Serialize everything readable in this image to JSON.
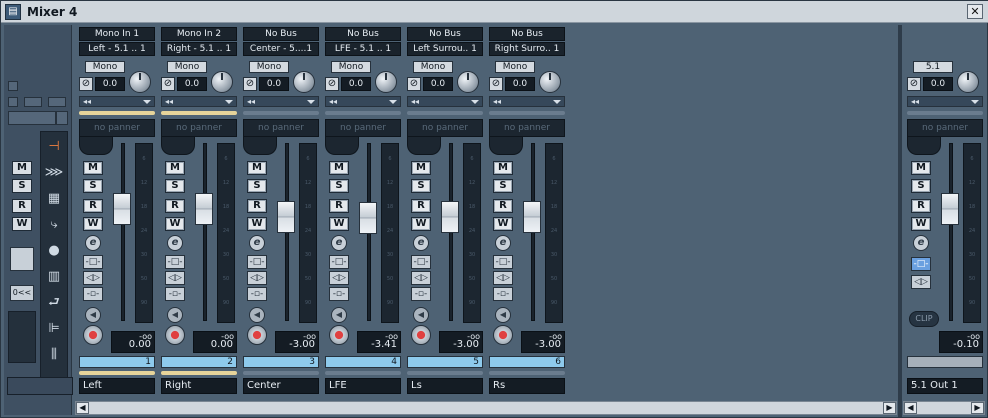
{
  "window": {
    "title": "Mixer 4",
    "close_glyph": "✕",
    "app_icon": "mixer-app-icon"
  },
  "left_panel": {
    "letters": [
      "M",
      "S",
      "R",
      "W"
    ],
    "view_button_label": "0<<",
    "tools": [
      "input-icon",
      "monitor-icon",
      "sends-icon",
      "insert-icon",
      "midi-icon",
      "keyboard-icon",
      "return-icon",
      "fader-icon",
      "eq-icon"
    ]
  },
  "channels": [
    {
      "input": "Mono In 1",
      "output": "Left - 5.1 .. 1",
      "mono": "Mono",
      "gain": "0.0",
      "panner": "no panner",
      "level": "0.00",
      "level_peak": "-oo",
      "number": "1",
      "name": "Left",
      "fader_db": 0.0,
      "send_active": true
    },
    {
      "input": "Mono In 2",
      "output": "Right - 5.1 .. 1",
      "mono": "Mono",
      "gain": "0.0",
      "panner": "no panner",
      "level": "0.00",
      "level_peak": "-oo",
      "number": "2",
      "name": "Right",
      "fader_db": 0.0,
      "send_active": true
    },
    {
      "input": "No Bus",
      "output": "Center - 5....1",
      "mono": "Mono",
      "gain": "0.0",
      "panner": "no panner",
      "level": "-3.00",
      "level_peak": "-oo",
      "number": "3",
      "name": "Center",
      "fader_db": -3.0,
      "send_active": false
    },
    {
      "input": "No Bus",
      "output": "LFE - 5.1 .. 1",
      "mono": "Mono",
      "gain": "0.0",
      "panner": "no panner",
      "level": "-3.41",
      "level_peak": "-oo",
      "number": "4",
      "name": "LFE",
      "fader_db": -3.41,
      "send_active": false
    },
    {
      "input": "No Bus",
      "output": "Left Surrou.. 1",
      "mono": "Mono",
      "gain": "0.0",
      "panner": "no panner",
      "level": "-3.00",
      "level_peak": "-oo",
      "number": "5",
      "name": "Ls",
      "fader_db": -3.0,
      "send_active": false
    },
    {
      "input": "No Bus",
      "output": "Right Surro.. 1",
      "mono": "Mono",
      "gain": "0.0",
      "panner": "no panner",
      "level": "-3.00",
      "level_peak": "-oo",
      "number": "6",
      "name": "Rs",
      "fader_db": -3.0,
      "send_active": false
    }
  ],
  "output_channel": {
    "mono": "5.1",
    "gain": "0.0",
    "panner": "no panner",
    "level": "-0.10",
    "level_peak": "-oo",
    "clip": "CLIP",
    "name": "5.1 Out 1",
    "fader_db": -0.1
  },
  "meter_ticks": [
    "6",
    "12",
    "18",
    "24",
    "30",
    "50",
    "90"
  ],
  "button_labels": {
    "mute": "M",
    "solo": "S",
    "read": "R",
    "write": "W",
    "edit": "e"
  },
  "colors": {
    "accent_blue": "#8ecaec",
    "send_yellow": "#e6d49a",
    "record_red": "#e04040"
  }
}
